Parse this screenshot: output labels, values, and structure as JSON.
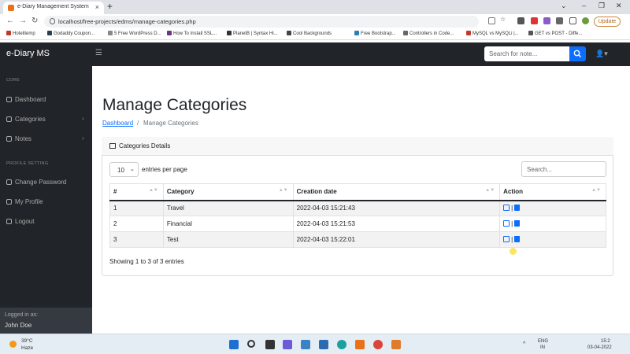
{
  "browser": {
    "tab_title": "e-Diary Management System",
    "url": "localhost/free-projects/edms/manage-categories.php",
    "update_label": "Update",
    "bookmarks": [
      "Hotelitemp",
      "Godaddy Coupon...",
      "5 Free WordPress D...",
      "How To Install SSL...",
      "PlanetB | Syntax Hi...",
      "Cool Backgrounds",
      "Free Bootstrap...",
      "Controllers in Code...",
      "MySQL vs MySQLi |...",
      "GET vs POST - Diffe..."
    ]
  },
  "topnav": {
    "brand": "e-Diary MS",
    "search_placeholder": "Search for note..."
  },
  "sidebar": {
    "core_heading": "CORE",
    "profile_heading": "PROFILE SETTING",
    "items": {
      "dashboard": "Dashboard",
      "categories": "Categories",
      "notes": "Notes",
      "change_password": "Change Password",
      "my_profile": "My Profile",
      "logout": "Logout"
    },
    "footer_label": "Logged in as:",
    "footer_user": "John Doe"
  },
  "main": {
    "title": "Manage Categories",
    "breadcrumb_link": "Dashboard",
    "breadcrumb_sep": "/",
    "breadcrumb_current": "Manage Categories",
    "card_title": "Categories Details",
    "page_size": "10",
    "entries_label": "entries per page",
    "search_placeholder": "Search...",
    "columns": [
      "#",
      "Category",
      "Creation date",
      "Action"
    ],
    "rows": [
      {
        "num": "1",
        "category": "Travel",
        "created": "2022-04-03 15:21:43"
      },
      {
        "num": "2",
        "category": "Financial",
        "created": "2022-04-03 15:21:53"
      },
      {
        "num": "3",
        "category": "Test",
        "created": "2022-04-03 15:22:01"
      }
    ],
    "action_sep": "|",
    "showing": "Showing 1 to 3 of 3 entries"
  },
  "taskbar": {
    "temp": "39°C",
    "weather": "Haze",
    "lang1": "ENG",
    "lang2": "IN",
    "time": "15:2",
    "date": "03-04-2022"
  },
  "colors": {
    "primary": "#0d6efd",
    "dark": "#212529"
  }
}
